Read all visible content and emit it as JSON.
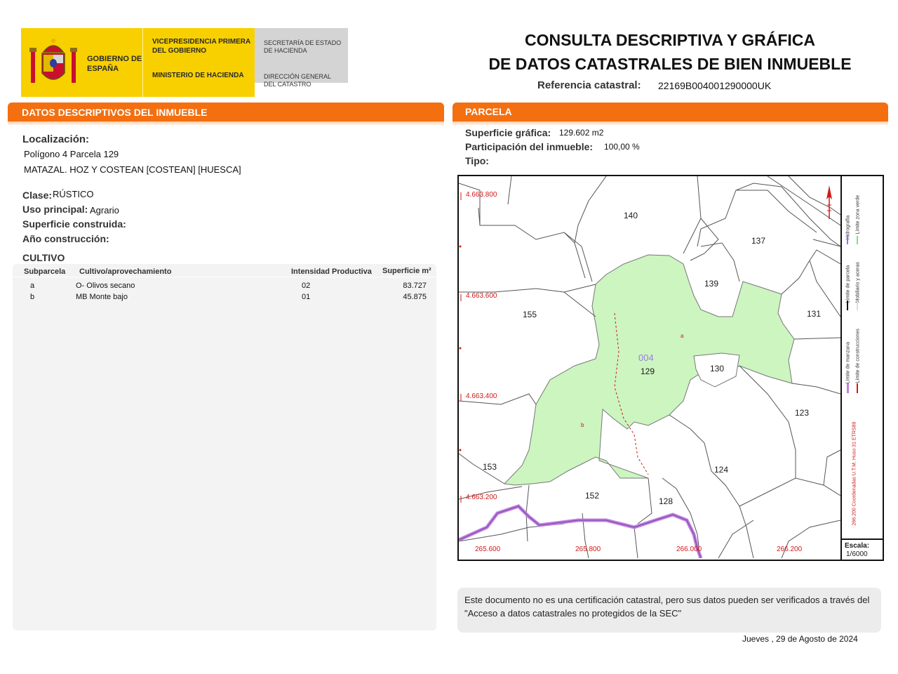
{
  "header": {
    "gobierno": "GOBIERNO DE ESPAÑA",
    "vicepresidencia": "VICEPRESIDENCIA PRIMERA DEL GOBIERNO",
    "ministerio": "MINISTERIO DE HACIENDA",
    "secretaria": "SECRETARÍA DE ESTADO DE HACIENDA",
    "direccion": "DIRECCIÓN GENERAL DEL CATASTRO",
    "title_line1": "CONSULTA DESCRIPTIVA Y GRÁFICA",
    "title_line2": "DE DATOS CATASTRALES DE BIEN INMUEBLE",
    "ref_label": "Referencia catastral:",
    "ref_value": "22169B004001290000UK"
  },
  "descriptivos": {
    "section_title": "DATOS DESCRIPTIVOS DEL INMUEBLE",
    "localizacion_label": "Localización:",
    "localizacion_line1": "Polígono 4 Parcela 129",
    "localizacion_line2": "MATAZAL. HOZ Y COSTEAN [COSTEAN] [HUESCA]",
    "clase_label": "Clase:",
    "clase_value": "RÚSTICO",
    "uso_label": "Uso principal:",
    "uso_value": "Agrario",
    "superficie_construida_label": "Superficie construida:",
    "ano_label": "Año construcción:"
  },
  "cultivo": {
    "title": "CULTIVO",
    "headers": [
      "Subparcela",
      "Cultivo/aprovechamiento",
      "Intensidad Productiva",
      "Superficie m²"
    ],
    "rows": [
      [
        "a",
        "O- Olivos secano",
        "02",
        "83.727"
      ],
      [
        "b",
        "MB Monte bajo",
        "01",
        "45.875"
      ]
    ]
  },
  "parcela": {
    "section_title": "PARCELA",
    "superficie_label": "Superficie gráfica:",
    "superficie_value": "129.602 m2",
    "participacion_label": "Participación del inmueble:",
    "participacion_value": "100,00 %",
    "tipo_label": "Tipo:"
  },
  "map": {
    "y_coords": [
      "4.663.800",
      "4.663.600",
      "4.663.400",
      "4.663.200"
    ],
    "x_coords": [
      "265.600",
      "265.800",
      "266.000",
      "266.200"
    ],
    "parcel_labels": [
      "140",
      "137",
      "139",
      "155",
      "131",
      "129",
      "130",
      "123",
      "153",
      "124",
      "152",
      "128"
    ],
    "poligono_label": "004",
    "subparcel_a": "a",
    "subparcel_b": "b",
    "legend": {
      "hidrografia": "Hidrografía",
      "limite_zona_verde": "Límite zona verde",
      "limite_parcela": "Límite de parcela",
      "mobiliario": "Mobiliario y aceras",
      "limite_manzana": "Límite de manzana",
      "limite_construcciones": "Límite de construcciones",
      "coordenadas": "266.200 Coordenadas U.T.M. Huso 31 ETRS89"
    },
    "scale_label": "Escala:",
    "scale_value": "1/6000",
    "colors": {
      "parcel_fill": "#ccf5c0",
      "coord_red": "#d01818",
      "river": "#c080e0"
    }
  },
  "footer": {
    "note": "Este documento no es una certificación catastral, pero sus datos pueden ser verificados a través del \"Acceso a datos catastrales no protegidos de la SEC\"",
    "date": "Jueves , 29 de Agosto de 2024"
  }
}
